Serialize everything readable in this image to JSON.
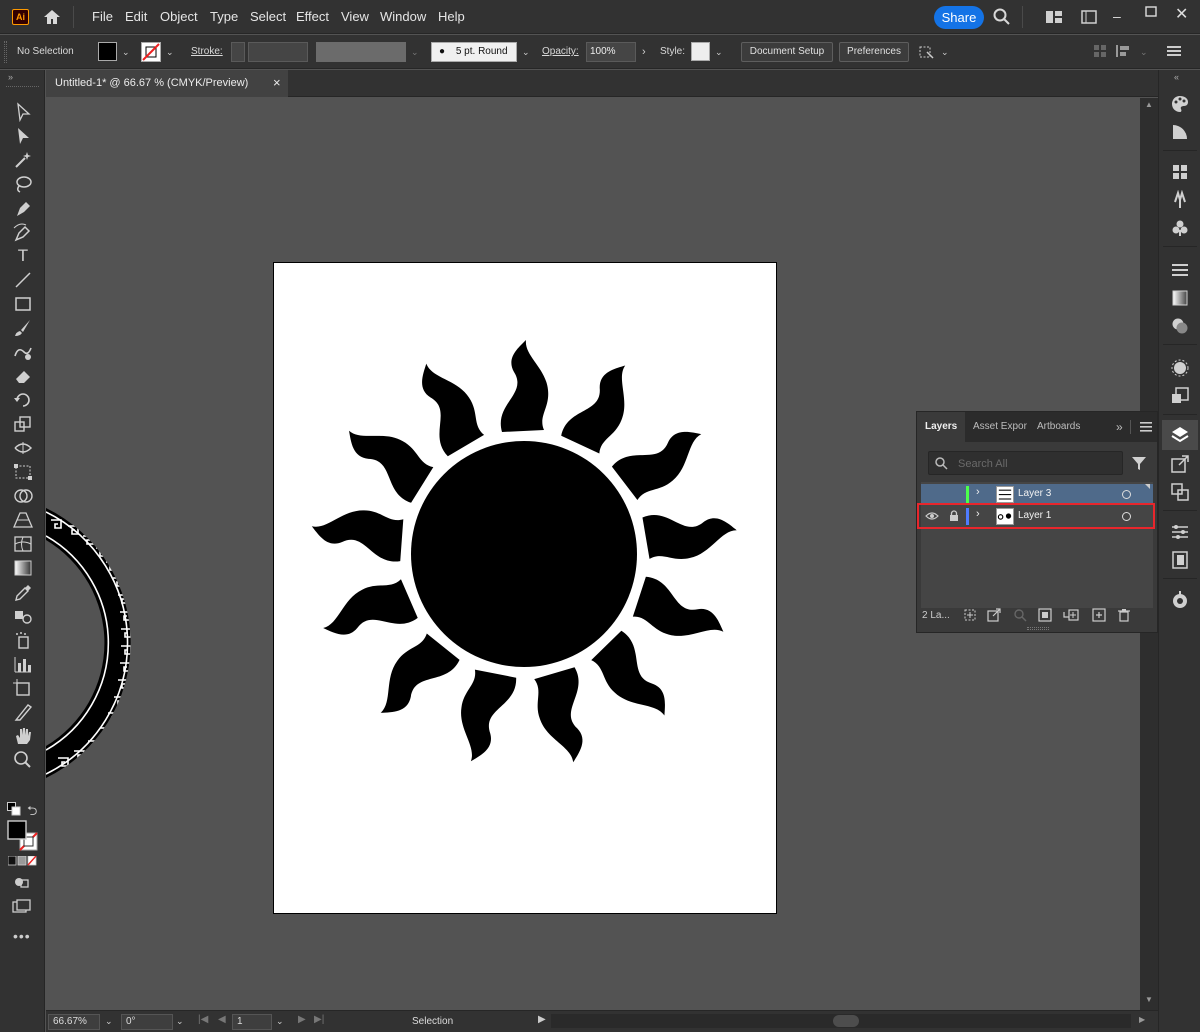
{
  "app": {
    "logo": "Ai",
    "share_label": "Share"
  },
  "menu": [
    "File",
    "Edit",
    "Object",
    "Type",
    "Select",
    "Effect",
    "View",
    "Window",
    "Help"
  ],
  "control": {
    "selection_status": "No Selection",
    "stroke_label": "Stroke:",
    "brush": "5 pt. Round",
    "opacity_label": "Opacity:",
    "opacity_value": "100%",
    "style_label": "Style:",
    "document_setup": "Document Setup",
    "preferences": "Preferences"
  },
  "document": {
    "tab_title": "Untitled-1* @ 66.67 % (CMYK/Preview)",
    "close": "×"
  },
  "layers_panel": {
    "tabs": [
      "Layers",
      "Asset Expor",
      "Artboards"
    ],
    "search_placeholder": "Search All",
    "layers": [
      {
        "name": "Layer 3",
        "color": "#4cff4c",
        "selected": true,
        "visible": false,
        "locked": false
      },
      {
        "name": "Layer 1",
        "color": "#4f7cff",
        "selected": false,
        "visible": true,
        "locked": true
      }
    ],
    "layer_count": "2 La..."
  },
  "status": {
    "zoom": "66.67%",
    "rotation": "0°",
    "artboard_number": "1",
    "tool": "Selection"
  },
  "colors": {
    "highlight_box": "#e8262c",
    "accent": "#1473e6"
  }
}
